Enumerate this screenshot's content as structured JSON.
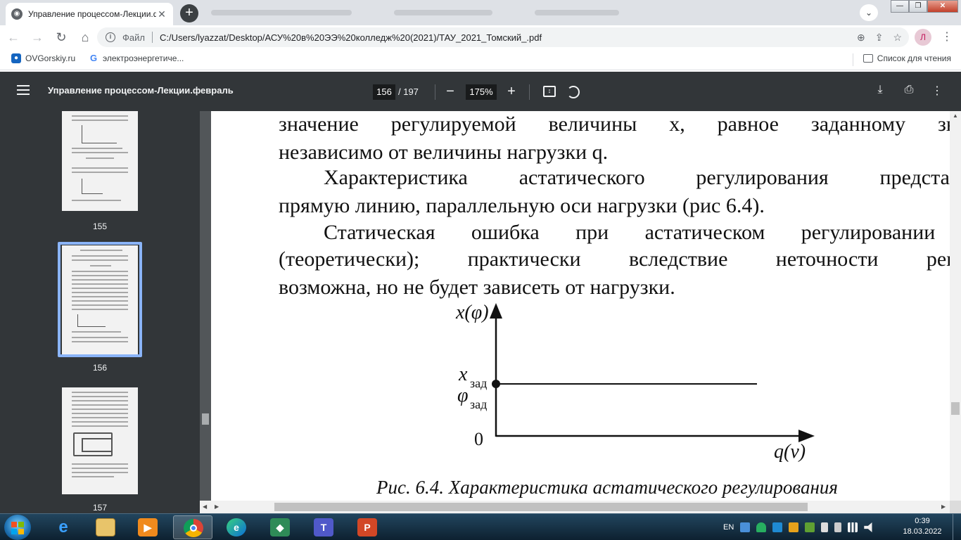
{
  "browser": {
    "tab_title": "Управление процессом-Лекции.февраль",
    "file_label": "Файл",
    "url": "C:/Users/lyazzat/Desktop/АСУ%20в%20ЭЭ%20колледж%20(2021)/ТАУ_2021_Томский_.pdf",
    "profile_initial": "Л"
  },
  "bookmarks": {
    "items": [
      {
        "label": "OVGorskiy.ru"
      },
      {
        "label": "электроэнергетиче..."
      }
    ],
    "reading_list": "Список для чтения"
  },
  "pdf_toolbar": {
    "doc_title": "Управление процессом-Лекции.февраль",
    "current_page": "156",
    "total_pages": "/ 197",
    "zoom": "175%"
  },
  "thumbnails": [
    {
      "page": "155"
    },
    {
      "page": "156",
      "selected": true
    },
    {
      "page": "157"
    }
  ],
  "document": {
    "lines": [
      "значение регулируемой величины x, равное заданному значению",
      "независимо от величины нагрузки q.",
      "Характеристика астатического регулирования представляет со",
      "прямую линию, параллельную оси нагрузки (рис 6.4).",
      "Статическая ошибка при астатическом регулировании равна н",
      "(теоретически); практически вследствие неточности регулятора",
      "возможна, но не будет зависеть от нагрузки."
    ],
    "figure": {
      "y_axis_label": "x(φ)",
      "x_axis_label": "q(ν)",
      "origin_label": "0",
      "setpoint_x_label": "x",
      "setpoint_x_sub": "зад",
      "setpoint_phi_label": "φ",
      "setpoint_phi_sub": "зад"
    },
    "caption": "Рис. 6.4. Характеристика астатического регулирования"
  },
  "taskbar": {
    "language": "EN",
    "time": "0:39",
    "date": "18.03.2022"
  },
  "colors": {
    "pdf_toolbar_bg": "#323639",
    "viewer_bg": "#525659",
    "selection_border": "#8ab4f8",
    "tab_strip_bg": "#dee1e6"
  }
}
